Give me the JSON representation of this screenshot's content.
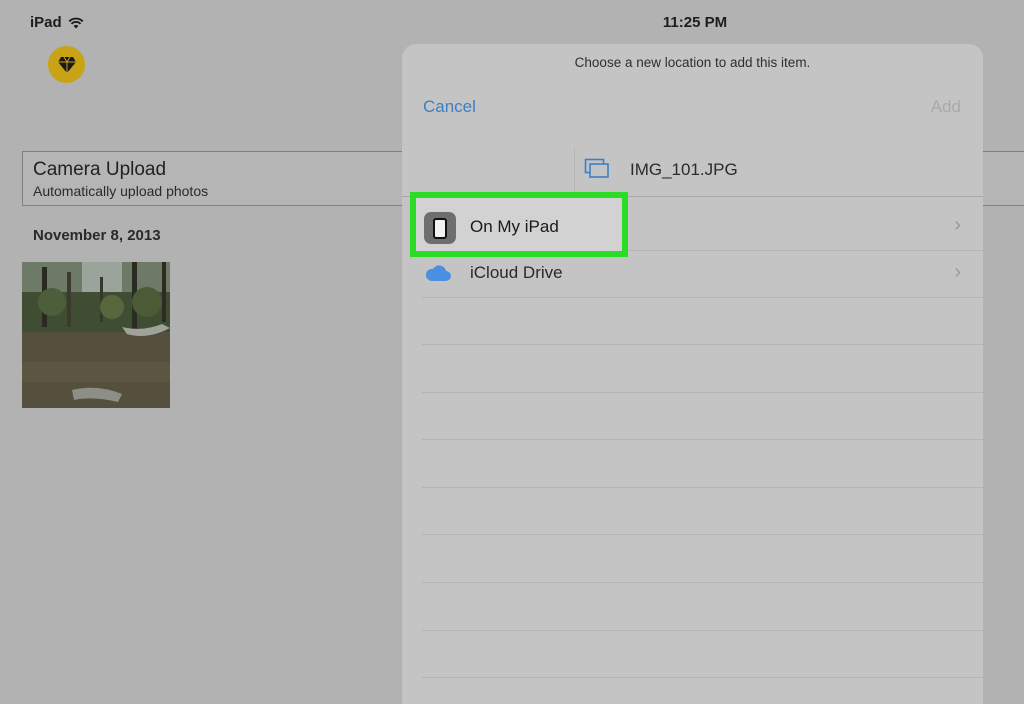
{
  "status": {
    "carrier": "iPad",
    "time": "11:25 PM"
  },
  "camera_upload": {
    "title": "Camera Upload",
    "subtitle": "Automatically upload photos"
  },
  "date_heading": "November 8, 2013",
  "sheet": {
    "prompt": "Choose a new location to add this item.",
    "cancel_label": "Cancel",
    "add_label": "Add",
    "file_name": "IMG_101.JPG",
    "locations": [
      {
        "label": "On My iPad",
        "icon": "ipad-icon",
        "highlighted": true
      },
      {
        "label": "iCloud Drive",
        "icon": "icloud-icon",
        "highlighted": false
      }
    ]
  },
  "colors": {
    "accent": "#3f7ec7",
    "highlight": "#2bdc26",
    "logo": "#c8a315"
  }
}
